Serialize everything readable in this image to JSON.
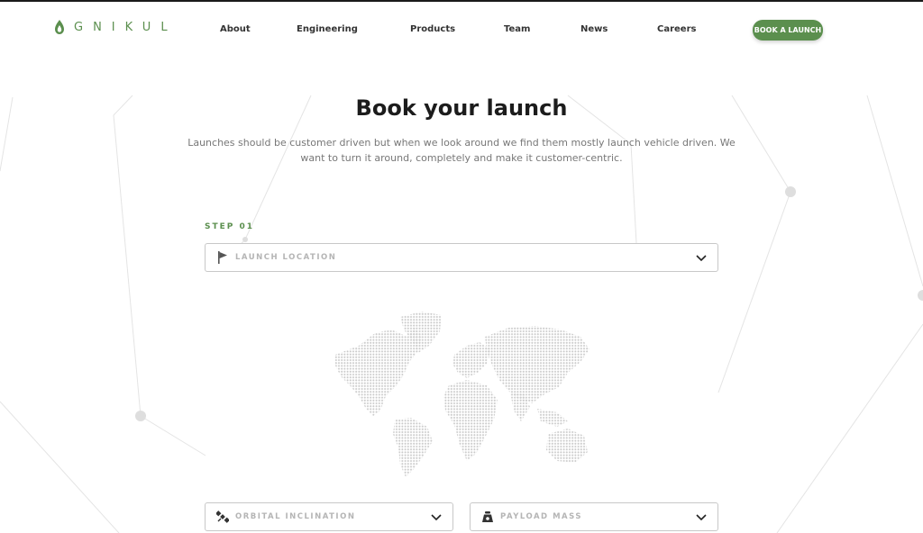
{
  "brand": {
    "name": "GNIKUL"
  },
  "nav": {
    "items": [
      {
        "label": "About"
      },
      {
        "label": "Engineering"
      },
      {
        "label": "Products"
      },
      {
        "label": "Team"
      },
      {
        "label": "News"
      },
      {
        "label": "Careers"
      }
    ],
    "cta_label": "BOOK A LAUNCH"
  },
  "hero": {
    "title": "Book your launch",
    "subtitle": "Launches should be customer driven but when we look around we find them mostly launch vehicle driven. We want to turn it around, completely and make it customer-centric."
  },
  "form": {
    "step_label": "STEP 01",
    "launch_location": {
      "placeholder": "LAUNCH LOCATION",
      "icon": "flag-icon"
    },
    "orbital_inclination": {
      "placeholder": "ORBITAL INCLINATION",
      "icon": "satellite-icon"
    },
    "payload_mass": {
      "placeholder": "PAYLOAD MASS",
      "icon": "weight-icon"
    }
  },
  "colors": {
    "accent": "#5b8f4e",
    "text": "#1c1c1c",
    "muted": "#777777"
  }
}
